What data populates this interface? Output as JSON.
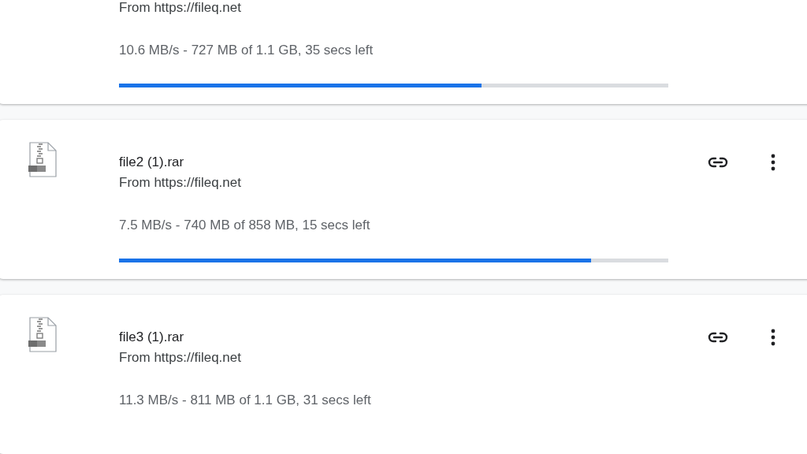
{
  "downloads": [
    {
      "source": "From https://fileq.net",
      "status": "10.6 MB/s - 727 MB of 1.1 GB, 35 secs left",
      "level": 0.66
    },
    {
      "title": "file2 (1).rar",
      "source": "From https://fileq.net",
      "status": "7.5 MB/s - 740 MB of 858 MB, 15 secs left",
      "level": 0.86
    },
    {
      "title": "file3 (1).rar",
      "source": "From https://fileq.net",
      "status": "11.3 MB/s - 811 MB of 1.1 GB, 31 secs left"
    }
  ]
}
